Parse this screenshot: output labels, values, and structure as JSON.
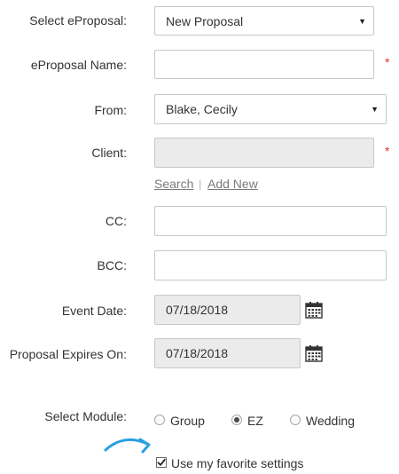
{
  "form": {
    "select_eproposal": {
      "label": "Select eProposal:",
      "value": "New Proposal"
    },
    "eproposal_name": {
      "label": "eProposal Name:",
      "value": "",
      "required_mark": "*"
    },
    "from": {
      "label": "From:",
      "value": "Blake, Cecily"
    },
    "client": {
      "label": "Client:",
      "value": "",
      "required_mark": "*"
    },
    "client_links": {
      "search": "Search",
      "separator": "|",
      "add_new": "Add New"
    },
    "cc": {
      "label": "CC:",
      "value": ""
    },
    "bcc": {
      "label": "BCC:",
      "value": ""
    },
    "event_date": {
      "label": "Event Date:",
      "value": "07/18/2018"
    },
    "proposal_expires": {
      "label": "Proposal Expires On:",
      "value": "07/18/2018"
    },
    "module": {
      "label": "Select Module:",
      "options": [
        "Group",
        "EZ",
        "Wedding"
      ],
      "selected": "EZ"
    },
    "favorite": {
      "label": "Use my favorite settings",
      "checked": true
    }
  },
  "icons": {
    "dropdown": "chevron-down-icon",
    "calendar": "calendar-icon",
    "hint_arrow": "curved-arrow-icon"
  },
  "colors": {
    "required": "#e03131",
    "hint_arrow": "#2b9fe0",
    "readonly_bg": "#ebebeb"
  }
}
